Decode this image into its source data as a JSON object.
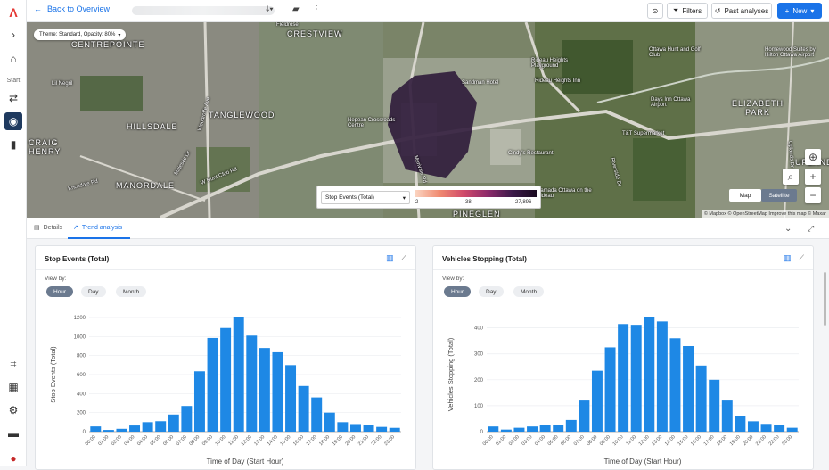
{
  "topbar": {
    "back_label": "Back to Overview",
    "filters_label": "Filters",
    "past_analyses_label": "Past analyses",
    "new_label": "New"
  },
  "sidebar": {
    "start_label": "Start"
  },
  "map": {
    "theme_label": "Theme: Standard, Opacity: 80%",
    "labels": [
      {
        "text": "CENTREPOINTE",
        "cls": "big"
      },
      {
        "text": "CRESTVIEW",
        "cls": "big"
      },
      {
        "text": "Fieldrose",
        "cls": "small"
      },
      {
        "text": "Sandman Hotel",
        "cls": "small"
      },
      {
        "text": "Rideau Heights Playground",
        "cls": "small"
      },
      {
        "text": "Rideau Heights Inn",
        "cls": "small"
      },
      {
        "text": "Ottawa Hunt and Golf Club",
        "cls": "small"
      },
      {
        "text": "Homewood Suites by Hilton Ottawa Airport",
        "cls": "small"
      },
      {
        "text": "Lil Negril",
        "cls": "small"
      },
      {
        "text": "TANGLEWOOD",
        "cls": "big"
      },
      {
        "text": "HILLSDALE",
        "cls": "big"
      },
      {
        "text": "Nepean Crossroads Centre",
        "cls": "small"
      },
      {
        "text": "ELIZABETH PARK",
        "cls": "big"
      },
      {
        "text": "Days Inn Ottawa Airport",
        "cls": "small"
      },
      {
        "text": "T&T Supermarket",
        "cls": "small"
      },
      {
        "text": "CRAIG HENRY",
        "cls": "big"
      },
      {
        "text": "Cindy's Restaurant",
        "cls": "small"
      },
      {
        "text": "MANORDALE",
        "cls": "big"
      },
      {
        "text": "Ramada Ottawa on the Rideau",
        "cls": "small"
      },
      {
        "text": "PINEGLEN",
        "cls": "big"
      },
      {
        "text": "Woodroffe Ave",
        "cls": "small"
      },
      {
        "text": "Merivale Rd",
        "cls": "small"
      },
      {
        "text": "W Hunt Club Rd",
        "cls": "small"
      },
      {
        "text": "Majestic Dr",
        "cls": "small"
      },
      {
        "text": "Knoxdale Rd",
        "cls": "small"
      },
      {
        "text": "Riverside Dr",
        "cls": "small"
      },
      {
        "text": "Uplands Dr",
        "cls": "small"
      },
      {
        "text": "UPLANDS",
        "cls": "big"
      }
    ],
    "legend": {
      "metric": "Stop Events (Total)",
      "min": "2",
      "mid": "38",
      "max": "27,896"
    },
    "map_button": "Map",
    "satellite_button": "Satellite",
    "attribution": "© Mapbox © OpenStreetMap Improve this map © Maxar"
  },
  "tabs": {
    "details_label": "Details",
    "trend_label": "Trend analysis"
  },
  "cards": [
    {
      "title": "Stop Events (Total)",
      "view_by": "View by:",
      "chips": [
        "Hour",
        "Day",
        "Month"
      ]
    },
    {
      "title": "Vehicles Stopping (Total)",
      "view_by": "View by:",
      "chips": [
        "Hour",
        "Day",
        "Month"
      ]
    }
  ],
  "chart_data": [
    {
      "type": "bar",
      "title": "Stop Events (Total)",
      "xlabel": "Time of Day (Start Hour)",
      "ylabel": "Stop Events (Total)",
      "ylim": [
        0,
        1200
      ],
      "yticks": [
        0,
        200,
        400,
        600,
        800,
        1000,
        1200
      ],
      "categories": [
        "00:00",
        "01:00",
        "02:00",
        "03:00",
        "04:00",
        "05:00",
        "06:00",
        "07:00",
        "08:00",
        "09:00",
        "10:00",
        "11:00",
        "12:00",
        "13:00",
        "14:00",
        "15:00",
        "16:00",
        "17:00",
        "18:00",
        "19:00",
        "20:00",
        "21:00",
        "22:00",
        "23:00"
      ],
      "values": [
        55,
        18,
        30,
        65,
        100,
        110,
        180,
        270,
        635,
        985,
        1090,
        1200,
        1010,
        880,
        835,
        700,
        480,
        360,
        200,
        100,
        80,
        75,
        50,
        40
      ],
      "color": "#1e88e5"
    },
    {
      "type": "bar",
      "title": "Vehicles Stopping (Total)",
      "xlabel": "Time of Day (Start Hour)",
      "ylabel": "Vehicles Stopping (Total)",
      "ylim": [
        0,
        440
      ],
      "yticks": [
        0,
        100,
        200,
        300,
        400
      ],
      "categories": [
        "00:00",
        "01:00",
        "02:00",
        "03:00",
        "04:00",
        "05:00",
        "06:00",
        "07:00",
        "08:00",
        "09:00",
        "10:00",
        "11:00",
        "12:00",
        "13:00",
        "14:00",
        "15:00",
        "16:00",
        "17:00",
        "18:00",
        "19:00",
        "20:00",
        "21:00",
        "22:00",
        "23:00"
      ],
      "values": [
        20,
        8,
        15,
        20,
        25,
        25,
        45,
        120,
        235,
        325,
        415,
        412,
        440,
        425,
        360,
        330,
        255,
        200,
        120,
        60,
        40,
        30,
        25,
        15
      ],
      "color": "#1e88e5"
    }
  ]
}
